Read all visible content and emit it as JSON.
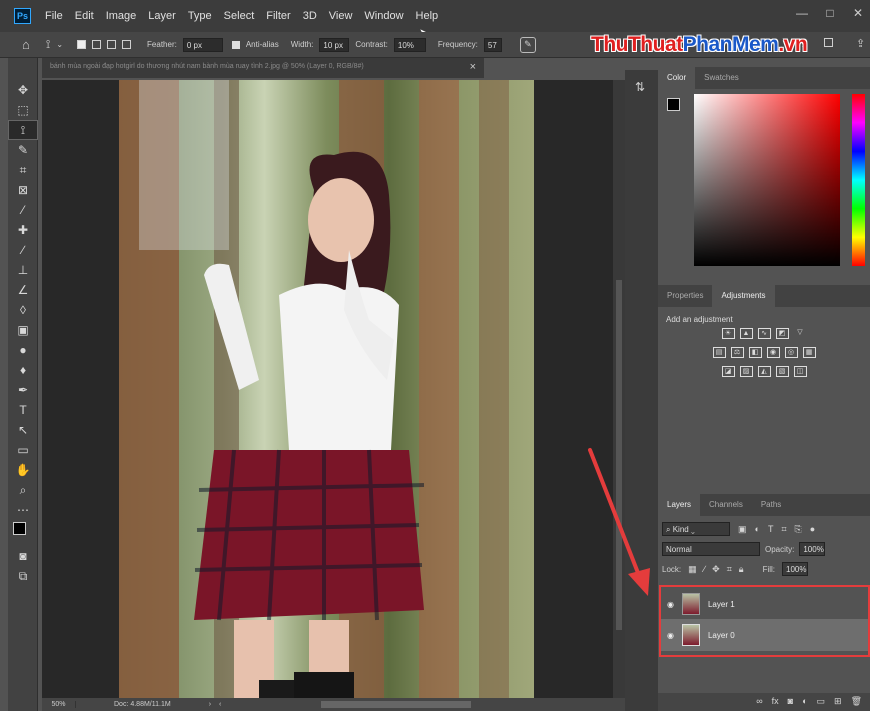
{
  "menubar": {
    "logo": "Ps",
    "items": [
      "File",
      "Edit",
      "Image",
      "Layer",
      "Type",
      "Select",
      "Filter",
      "3D",
      "View",
      "Window",
      "Help"
    ],
    "window_controls": [
      "—",
      "□",
      "✕"
    ]
  },
  "options": {
    "feather_label": "Feather:",
    "feather_value": "0 px",
    "antialias_label": "Anti-alias",
    "width_label": "Width:",
    "width_value": "10 px",
    "contrast_label": "Contrast:",
    "contrast_value": "10%",
    "frequency_label": "Frequency:",
    "frequency_value": "57"
  },
  "brand": {
    "part1": "ThuThuat",
    "part2": "PhanMem",
    "part3": ".vn"
  },
  "document": {
    "tab_title": "bánh mùa ngoài đạp hotgirl do thương nhút nam bành mùa ruay tình 2.jpg @ 50% (Layer 0, RGB/8#)",
    "zoom": "50%",
    "doc_size": "Doc: 4.88M/11.1M"
  },
  "color_panel": {
    "tabs": [
      "Color",
      "Swatches"
    ]
  },
  "adjustments_panel": {
    "tabs": [
      "Properties",
      "Adjustments"
    ],
    "heading": "Add an adjustment"
  },
  "layers_panel": {
    "tabs": [
      "Layers",
      "Channels",
      "Paths"
    ],
    "filter_kind": "Kind",
    "blend_mode": "Normal",
    "opacity_label": "Opacity:",
    "opacity_value": "100%",
    "lock_label": "Lock:",
    "fill_label": "Fill:",
    "fill_value": "100%",
    "layers": [
      {
        "name": "Layer 1"
      },
      {
        "name": "Layer 0"
      }
    ]
  },
  "colors": {
    "accent_red": "#e43c3c",
    "brand_red": "#e02020",
    "brand_blue": "#1a58c8"
  }
}
